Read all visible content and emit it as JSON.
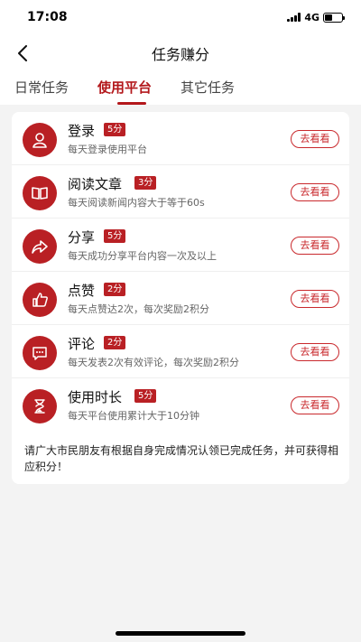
{
  "status": {
    "time": "17:08",
    "network": "4G"
  },
  "nav": {
    "title": "任务赚分"
  },
  "tabs": [
    {
      "label": "日常任务",
      "active": false
    },
    {
      "label": "使用平台",
      "active": true
    },
    {
      "label": "其它任务",
      "active": false
    }
  ],
  "tasks": [
    {
      "icon": "user-login-icon",
      "title": "登录",
      "badge": "5分",
      "desc": "每天登录使用平台",
      "button": "去看看"
    },
    {
      "icon": "open-book-icon",
      "title": "阅读文章",
      "badge": "3分",
      "desc": "每天阅读新闻内容大于等于60s",
      "button": "去看看"
    },
    {
      "icon": "share-arrow-icon",
      "title": "分享",
      "badge": "5分",
      "desc": "每天成功分享平台内容一次及以上",
      "button": "去看看"
    },
    {
      "icon": "thumbs-up-icon",
      "title": "点赞",
      "badge": "2分",
      "desc": "每天点赞达2次，每次奖励2积分",
      "button": "去看看"
    },
    {
      "icon": "comment-bubble-icon",
      "title": "评论",
      "badge": "2分",
      "desc": "每天发表2次有效评论，每次奖励2积分",
      "button": "去看看"
    },
    {
      "icon": "hourglass-icon",
      "title": "使用时长",
      "badge": "5分",
      "desc": "每天平台使用累计大于10分钟",
      "button": "去看看"
    }
  ],
  "note": "请广大市民朋友有根据自身完成情况认领已完成任务，并可获得相应积分！",
  "colors": {
    "accent": "#b92024",
    "background": "#f3f3f3"
  }
}
